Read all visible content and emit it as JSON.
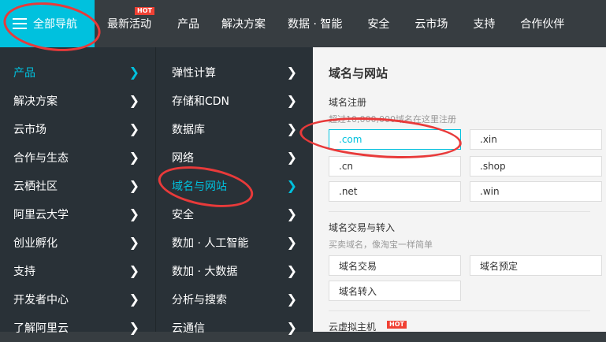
{
  "header": {
    "nav_toggle_label": "全部导航",
    "items": [
      {
        "label": "最新活动",
        "badge": "HOT"
      },
      {
        "label": "产品"
      },
      {
        "label": "解决方案"
      },
      {
        "label": "数据 · 智能"
      },
      {
        "label": "安全"
      },
      {
        "label": "云市场"
      },
      {
        "label": "支持"
      },
      {
        "label": "合作伙伴"
      }
    ]
  },
  "primary_menu": [
    {
      "label": "产品",
      "active": true
    },
    {
      "label": "解决方案"
    },
    {
      "label": "云市场"
    },
    {
      "label": "合作与生态"
    },
    {
      "label": "云栖社区"
    },
    {
      "label": "阿里云大学"
    },
    {
      "label": "创业孵化"
    },
    {
      "label": "支持"
    },
    {
      "label": "开发者中心"
    },
    {
      "label": "了解阿里云"
    }
  ],
  "secondary_menu": [
    {
      "label": "弹性计算"
    },
    {
      "label": "存储和CDN"
    },
    {
      "label": "数据库"
    },
    {
      "label": "网络"
    },
    {
      "label": "域名与网站",
      "active": true
    },
    {
      "label": "安全"
    },
    {
      "label": "数加 · 人工智能"
    },
    {
      "label": "数加 · 大数据"
    },
    {
      "label": "分析与搜索"
    },
    {
      "label": "云通信"
    }
  ],
  "panel": {
    "title": "域名与网站",
    "registration": {
      "title": "域名注册",
      "subtitle": "超过10,000,000域名在这里注册",
      "tiles": [
        ".com",
        ".xin",
        ".cn",
        ".shop",
        ".net",
        ".win"
      ]
    },
    "trading": {
      "title": "域名交易与转入",
      "subtitle": "买卖域名，像淘宝一样简单",
      "tiles": [
        "域名交易",
        "域名预定",
        "域名转入"
      ]
    },
    "hosting": {
      "title": "云虚拟主机",
      "badge": "HOT"
    }
  },
  "colors": {
    "accent": "#00c1de",
    "topbar": "#373d41",
    "menu_bg": "#293137",
    "panel_bg": "#f4f4f4",
    "annotation": "#e83a3a",
    "hot": "#f04134"
  }
}
